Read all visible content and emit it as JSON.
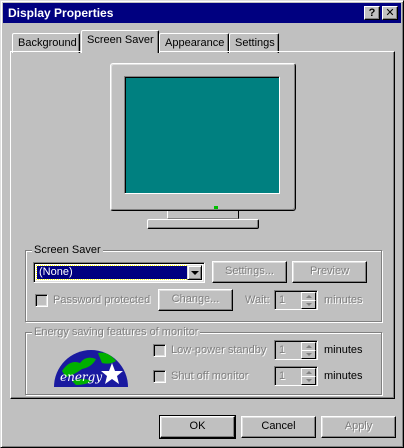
{
  "window": {
    "title": "Display Properties",
    "help_button": "?",
    "close_button": "✕"
  },
  "tabs": [
    {
      "label": "Background"
    },
    {
      "label": "Screen Saver"
    },
    {
      "label": "Appearance"
    },
    {
      "label": "Settings"
    }
  ],
  "active_tab": "Screen Saver",
  "monitor_preview": {
    "screen_color": "#008080"
  },
  "screen_saver": {
    "group_label": "Screen Saver",
    "selected": "(None)",
    "settings_button": "Settings...",
    "preview_button": "Preview",
    "password_label": "Password protected",
    "password_checked": false,
    "change_button": "Change...",
    "wait_label": "Wait:",
    "wait_value": "1",
    "wait_unit": "minutes"
  },
  "energy": {
    "group_label": "Energy saving features of monitor",
    "logo_text": "energy",
    "low_power_label": "Low-power standby",
    "low_power_checked": false,
    "low_power_value": "1",
    "low_power_unit": "minutes",
    "shutoff_label": "Shut off monitor",
    "shutoff_checked": false,
    "shutoff_value": "1",
    "shutoff_unit": "minutes"
  },
  "buttons": {
    "ok": "OK",
    "cancel": "Cancel",
    "apply": "Apply"
  },
  "colors": {
    "title_bar": "#000080",
    "face": "#c0c0c0",
    "selection": "#000080"
  }
}
